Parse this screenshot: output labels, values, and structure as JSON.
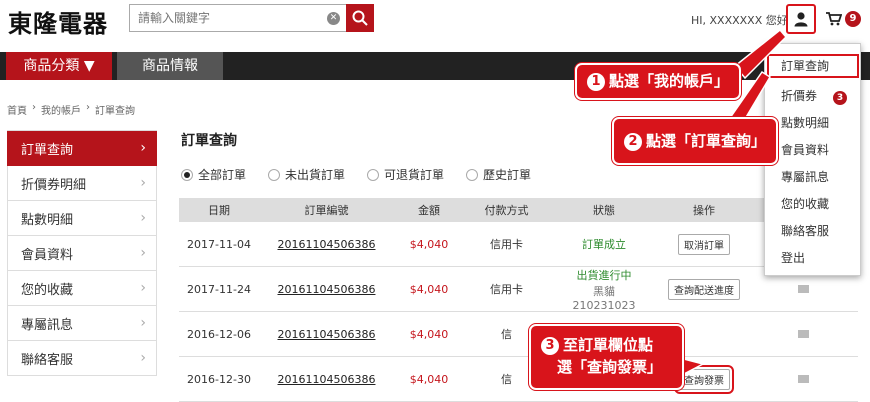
{
  "header": {
    "logo": "東隆電器",
    "search_placeholder": "請輸入關鍵字",
    "greeting": "HI, XXXXXXX 您好",
    "cart_count": "9"
  },
  "nav": {
    "category": "商品分類 ▼",
    "info": "商品情報"
  },
  "breadcrumb": [
    "首頁",
    "我的帳戶",
    "訂單查詢"
  ],
  "sidebar": {
    "items": [
      {
        "label": "訂單查詢"
      },
      {
        "label": "折價券明細"
      },
      {
        "label": "點數明細"
      },
      {
        "label": "會員資料"
      },
      {
        "label": "您的收藏"
      },
      {
        "label": "專屬訊息"
      },
      {
        "label": "聯絡客服"
      }
    ]
  },
  "main": {
    "title": "訂單查詢",
    "filters": [
      "全部訂單",
      "未出貨訂單",
      "可退貨訂單",
      "歷史訂單"
    ],
    "columns": [
      "日期",
      "訂單編號",
      "金額",
      "付款方式",
      "狀態",
      "操作"
    ],
    "rows": [
      {
        "date": "2017-11-04",
        "order_no": "20161104506386",
        "amount": "$4,040",
        "payment": "信用卡",
        "status": "訂單成立",
        "status_sub1": "",
        "status_sub2": "",
        "action": "取消訂單"
      },
      {
        "date": "2017-11-24",
        "order_no": "20161104506386",
        "amount": "$4,040",
        "payment": "信用卡",
        "status": "出貨進行中",
        "status_sub1": "黑貓",
        "status_sub2": "210231023",
        "action": "查詢配送進度"
      },
      {
        "date": "2016-12-06",
        "order_no": "20161104506386",
        "amount": "$4,040",
        "payment": "信",
        "status": "",
        "status_sub1": "",
        "status_sub2": "",
        "action": ""
      },
      {
        "date": "2016-12-30",
        "order_no": "20161104506386",
        "amount": "$4,040",
        "payment": "信",
        "status": "",
        "status_sub1": "",
        "status_sub2": "",
        "action": "查詢發票"
      }
    ]
  },
  "dropdown": {
    "items": [
      "訂單查詢",
      "折價券",
      "點數明細",
      "會員資料",
      "專屬訊息",
      "您的收藏",
      "聯絡客服",
      "登出"
    ],
    "coupon_badge": "3"
  },
  "callouts": {
    "step1": {
      "num": "1",
      "text": "點選「我的帳戶」"
    },
    "step2": {
      "num": "2",
      "text": "點選「訂單查詢」"
    },
    "step3": {
      "num": "3",
      "line1": "至訂單欄位點",
      "line2": "選「查詢發票」"
    }
  },
  "colors": {
    "brand": "#b5141b",
    "callout": "#d8141b",
    "status_green": "#2e8b2e"
  }
}
